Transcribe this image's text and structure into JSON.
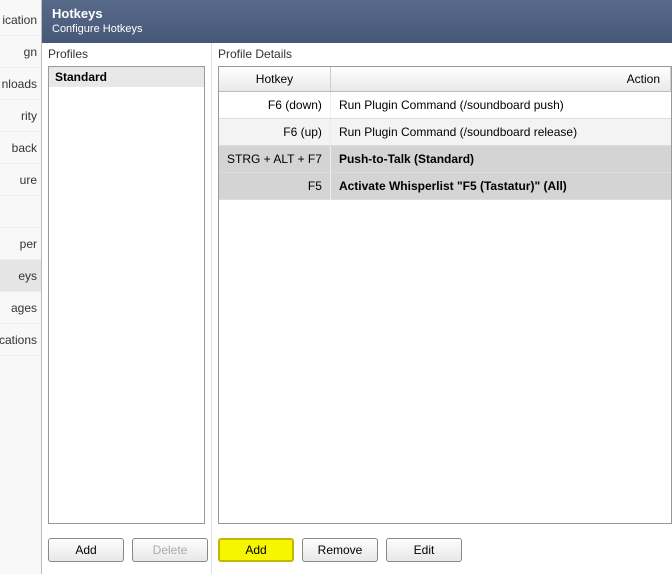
{
  "header": {
    "title": "Hotkeys",
    "subtitle": "Configure Hotkeys"
  },
  "sidebar": {
    "items": [
      {
        "label": "ication"
      },
      {
        "label": "gn"
      },
      {
        "label": "nloads"
      },
      {
        "label": "rity"
      },
      {
        "label": "back"
      },
      {
        "label": "ure"
      },
      {
        "label": ""
      },
      {
        "label": "per"
      },
      {
        "label": "eys"
      },
      {
        "label": "ages"
      },
      {
        "label": "ications"
      }
    ],
    "active_index": 8
  },
  "profiles": {
    "label": "Profiles",
    "items": [
      {
        "name": "Standard"
      }
    ],
    "buttons": {
      "add": "Add",
      "delete": "Delete"
    }
  },
  "details": {
    "label": "Profile Details",
    "columns": {
      "hotkey": "Hotkey",
      "action": "Action"
    },
    "rows": [
      {
        "hotkey": "F6 (down)",
        "action": "Run Plugin Command (/soundboard push)",
        "selected": false,
        "bold": false
      },
      {
        "hotkey": "F6 (up)",
        "action": "Run Plugin Command (/soundboard release)",
        "selected": false,
        "bold": false
      },
      {
        "hotkey": "STRG + ALT + F7",
        "action": "Push-to-Talk (Standard)",
        "selected": true,
        "bold": true
      },
      {
        "hotkey": "F5",
        "action": "Activate Whisperlist \"F5 (Tastatur)\" (All)",
        "selected": true,
        "bold": true
      }
    ],
    "buttons": {
      "add": "Add",
      "remove": "Remove",
      "edit": "Edit"
    }
  }
}
